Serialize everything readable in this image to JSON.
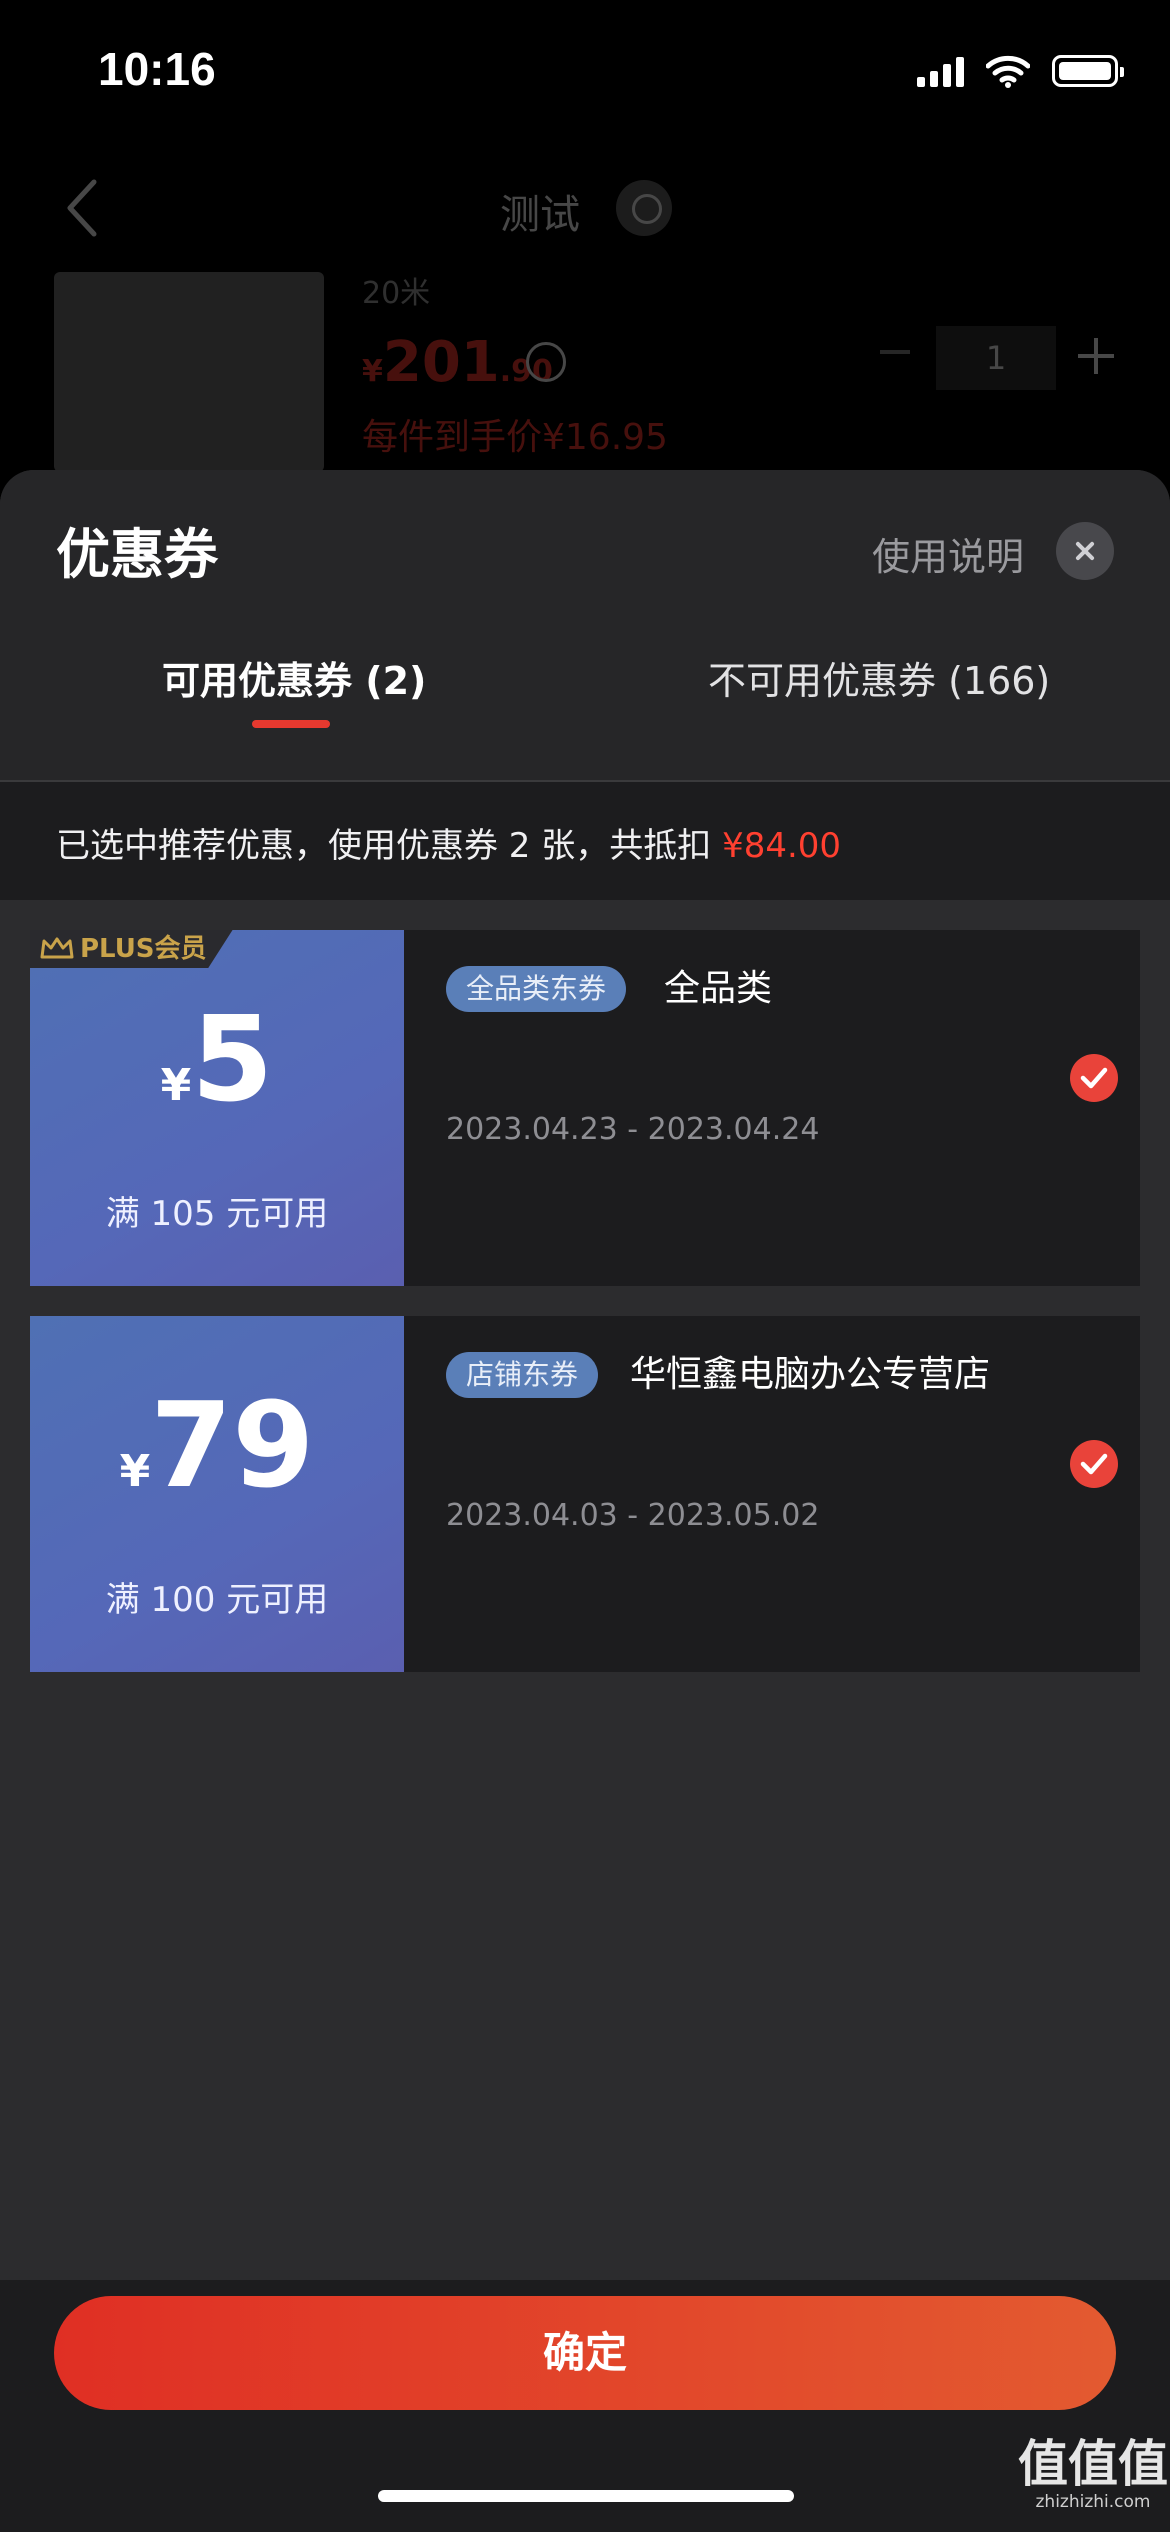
{
  "status_bar": {
    "time": "10:16"
  },
  "background_page": {
    "title": "测试",
    "product": {
      "spec": "20米",
      "price_symbol": "¥",
      "price_int": "201",
      "price_dec": ".90",
      "final_price": "每件到手价¥16.95",
      "quantity": "1"
    }
  },
  "sheet": {
    "title": "优惠券",
    "help_label": "使用说明",
    "tabs": [
      {
        "label": "可用优惠券 (2)",
        "active": true
      },
      {
        "label": "不可用优惠券 (166)",
        "active": false
      }
    ],
    "summary_prefix": "已选中推荐优惠，使用优惠券 2 张，共抵扣 ",
    "summary_amount": "¥84.00",
    "coupons": [
      {
        "badge": "PLUS会员",
        "symbol": "¥",
        "amount": "5",
        "condition": "满 105 元可用",
        "tag": "全品类东券",
        "name": "全品类",
        "date_range": "2023.04.23 - 2023.04.24",
        "selected": true
      },
      {
        "symbol": "¥",
        "amount": "79",
        "condition": "满 100 元可用",
        "tag": "店铺东券",
        "name": "华恒鑫电脑办公专营店",
        "date_range": "2023.04.03 - 2023.05.02",
        "selected": true
      }
    ],
    "confirm_label": "确定"
  },
  "watermark": {
    "main": "值值值",
    "sub": "zhizhizhi.com"
  },
  "colors": {
    "accent_red": "#e9433a",
    "coupon_blue": "#5568b8",
    "sheet_bg": "#2c2c2e",
    "plus_gold": "#c9a34a"
  },
  "icons": [
    "back-icon",
    "info-icon",
    "plus-icon",
    "close-icon",
    "crown-icon",
    "check-icon",
    "battery-icon",
    "wifi-icon",
    "signal-icon"
  ]
}
